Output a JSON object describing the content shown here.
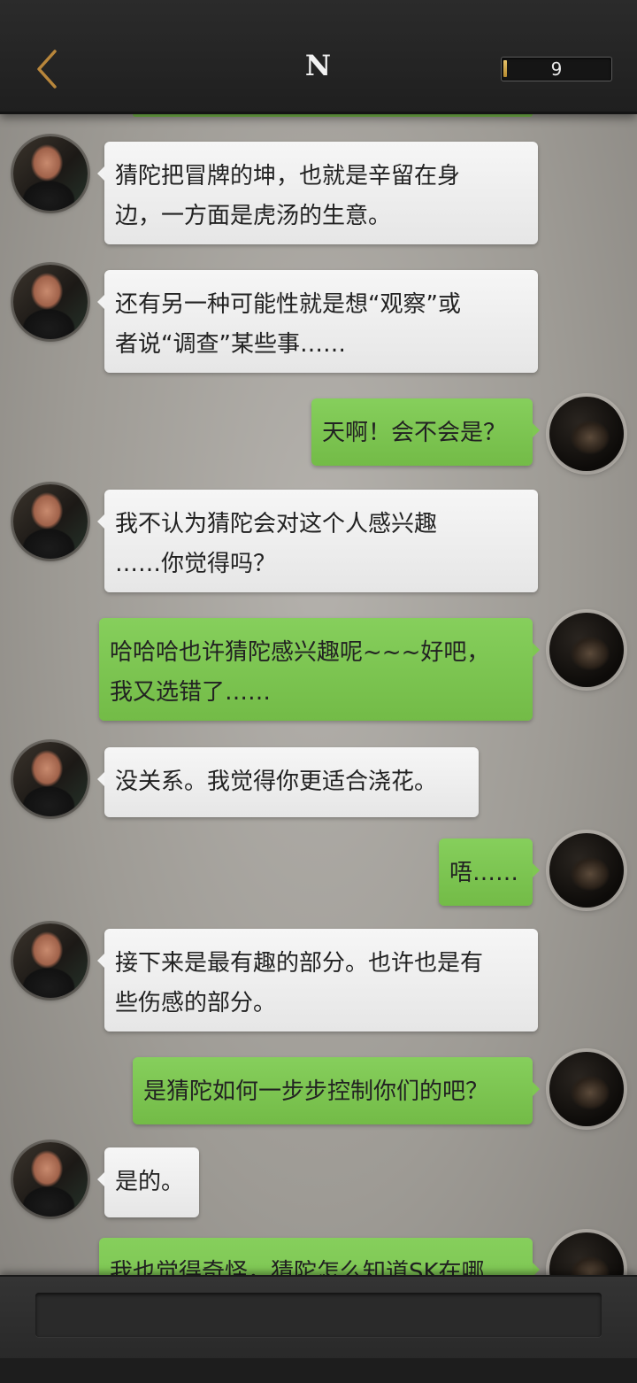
{
  "header": {
    "title": "N",
    "counter_value": "9",
    "counter_fill_fraction": 0.03
  },
  "messages": [
    {
      "side": "left",
      "text": "猜陀把冒牌的坤，也就是辛留在身\n边，一方面是虎汤的生意。"
    },
    {
      "side": "left",
      "text": "还有另一种可能性就是想“观察”或\n者说“调查”某些事……"
    },
    {
      "side": "right",
      "text": "天啊！会不会是？"
    },
    {
      "side": "left",
      "text": "我不认为猜陀会对这个人感兴趣\n……你觉得吗？"
    },
    {
      "side": "right",
      "text": "哈哈哈也许猜陀感兴趣呢~~~好吧，\n我又选错了……"
    },
    {
      "side": "left",
      "text": "没关系。我觉得你更适合浇花。"
    },
    {
      "side": "right",
      "text": "唔……"
    },
    {
      "side": "left",
      "text": "接下来是最有趣的部分。也许也是有\n些伤感的部分。"
    },
    {
      "side": "right",
      "text": "是猜陀如何一步步控制你们的吧？"
    },
    {
      "side": "left",
      "text": "是的。"
    },
    {
      "side": "right",
      "text": "我也觉得奇怪，猜陀怎么知道SK在哪"
    }
  ],
  "colors": {
    "right_bubble": "#7fc752",
    "left_bubble": "#f2f2f2",
    "header_bg": "#232323"
  },
  "icons": {
    "back": "chevron-left-icon"
  }
}
